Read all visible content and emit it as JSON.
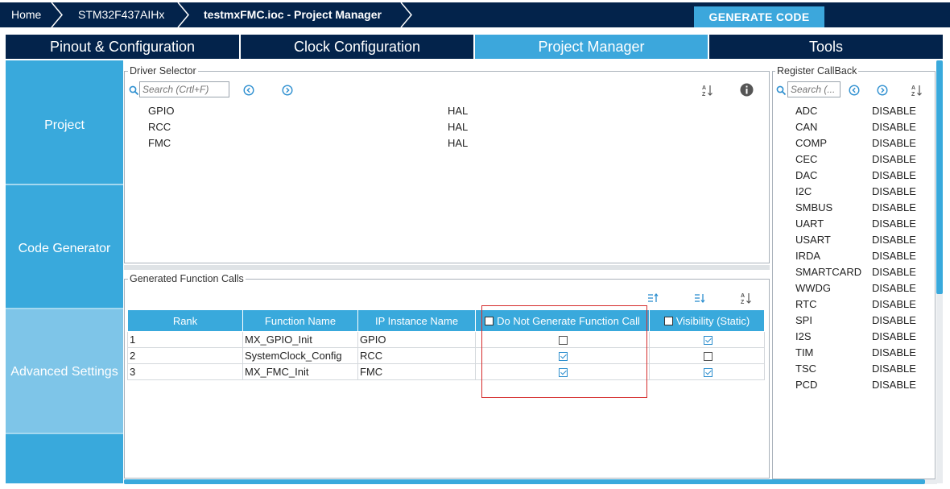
{
  "breadcrumb": {
    "home": "Home",
    "device": "STM32F437AIHx",
    "project": "testmxFMC.ioc - Project Manager"
  },
  "generate_button": "GENERATE CODE",
  "tabs": [
    "Pinout & Configuration",
    "Clock Configuration",
    "Project Manager",
    "Tools"
  ],
  "active_tab": "Project Manager",
  "leftnav": {
    "project": "Project",
    "code_generator": "Code Generator",
    "advanced_settings": "Advanced Settings"
  },
  "driver_selector": {
    "legend": "Driver Selector",
    "search_placeholder": "Search (Crtl+F)",
    "rows": [
      {
        "name": "GPIO",
        "driver": "HAL"
      },
      {
        "name": "RCC",
        "driver": "HAL"
      },
      {
        "name": "FMC",
        "driver": "HAL"
      }
    ]
  },
  "generated_calls": {
    "legend": "Generated Function Calls",
    "headers": {
      "rank": "Rank",
      "function_name": "Function Name",
      "ip_instance": "IP Instance Name",
      "do_not_generate": "Do Not Generate Function Call",
      "visibility": "Visibility (Static)"
    },
    "rows": [
      {
        "rank": "1",
        "function": "MX_GPIO_Init",
        "ip": "GPIO",
        "do_not_generate": false,
        "visibility": true
      },
      {
        "rank": "2",
        "function": "SystemClock_Config",
        "ip": "RCC",
        "do_not_generate": true,
        "visibility": false
      },
      {
        "rank": "3",
        "function": "MX_FMC_Init",
        "ip": "FMC",
        "do_not_generate": true,
        "visibility": true
      }
    ]
  },
  "register_callback": {
    "legend": "Register CallBack",
    "search_placeholder": "Search (...",
    "items": [
      {
        "name": "ADC",
        "value": "DISABLE"
      },
      {
        "name": "CAN",
        "value": "DISABLE"
      },
      {
        "name": "COMP",
        "value": "DISABLE"
      },
      {
        "name": "CEC",
        "value": "DISABLE"
      },
      {
        "name": "DAC",
        "value": "DISABLE"
      },
      {
        "name": "I2C",
        "value": "DISABLE"
      },
      {
        "name": "SMBUS",
        "value": "DISABLE"
      },
      {
        "name": "UART",
        "value": "DISABLE"
      },
      {
        "name": "USART",
        "value": "DISABLE"
      },
      {
        "name": "IRDA",
        "value": "DISABLE"
      },
      {
        "name": "SMARTCARD",
        "value": "DISABLE"
      },
      {
        "name": "WWDG",
        "value": "DISABLE"
      },
      {
        "name": "RTC",
        "value": "DISABLE"
      },
      {
        "name": "SPI",
        "value": "DISABLE"
      },
      {
        "name": "I2S",
        "value": "DISABLE"
      },
      {
        "name": "TIM",
        "value": "DISABLE"
      },
      {
        "name": "TSC",
        "value": "DISABLE"
      },
      {
        "name": "PCD",
        "value": "DISABLE"
      }
    ]
  },
  "icons": {
    "search": "search-icon",
    "prev": "arrow-left-circle-icon",
    "next": "arrow-right-circle-icon",
    "sort": "sort-az-icon",
    "info": "info-icon",
    "move_up": "move-up-icon",
    "move_down": "move-down-icon"
  },
  "colors": {
    "navy": "#03234b",
    "accent": "#3ca7dc",
    "highlight": "#d52b2b"
  }
}
